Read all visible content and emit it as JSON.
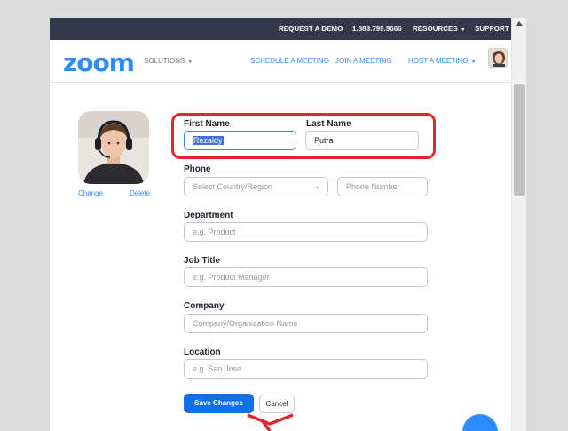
{
  "topbar": {
    "request_demo": "REQUEST A DEMO",
    "phone": "1.888.799.9666",
    "resources": "RESOURCES",
    "support": "SUPPORT"
  },
  "navbar": {
    "logo": "zoom",
    "solutions": "SOLUTIONS",
    "schedule": "SCHEDULE A MEETING",
    "join": "JOIN A MEETING",
    "host": "HOST A MEETING"
  },
  "photo": {
    "change": "Change",
    "delete": "Delete"
  },
  "form": {
    "first_name": {
      "label": "First Name",
      "value": "Rezaldy"
    },
    "last_name": {
      "label": "Last Name",
      "value": "Putra"
    },
    "phone": {
      "label": "Phone",
      "country_placeholder": "Select Country/Region",
      "number_placeholder": "Phone Number"
    },
    "department": {
      "label": "Department",
      "placeholder": "e.g. Product"
    },
    "job_title": {
      "label": "Job Title",
      "placeholder": "e.g. Product Manager"
    },
    "company": {
      "label": "Company",
      "placeholder": "Company/Organization Name"
    },
    "location": {
      "label": "Location",
      "placeholder": "e.g. San Jose"
    }
  },
  "buttons": {
    "save": "Save Changes",
    "cancel": "Cancel"
  },
  "colors": {
    "brand_blue": "#2d8cff",
    "topbar_bg": "#35384a",
    "primary_button": "#0e71eb",
    "annotation_red": "#e0272f"
  }
}
